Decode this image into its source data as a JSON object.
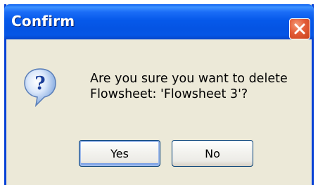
{
  "dialog": {
    "title": "Confirm",
    "message_line1": "Are you sure you want to delete",
    "message_line2": "Flowsheet: 'Flowsheet 3'?",
    "icon": "question-icon",
    "close_icon": "close-icon"
  },
  "buttons": {
    "yes_label": "Yes",
    "no_label": "No"
  },
  "colors": {
    "titlebar": "#0659ea",
    "window_border": "#0842d6",
    "body": "#ece9d8",
    "close_button": "#e35c38",
    "button_border": "#003c74"
  }
}
